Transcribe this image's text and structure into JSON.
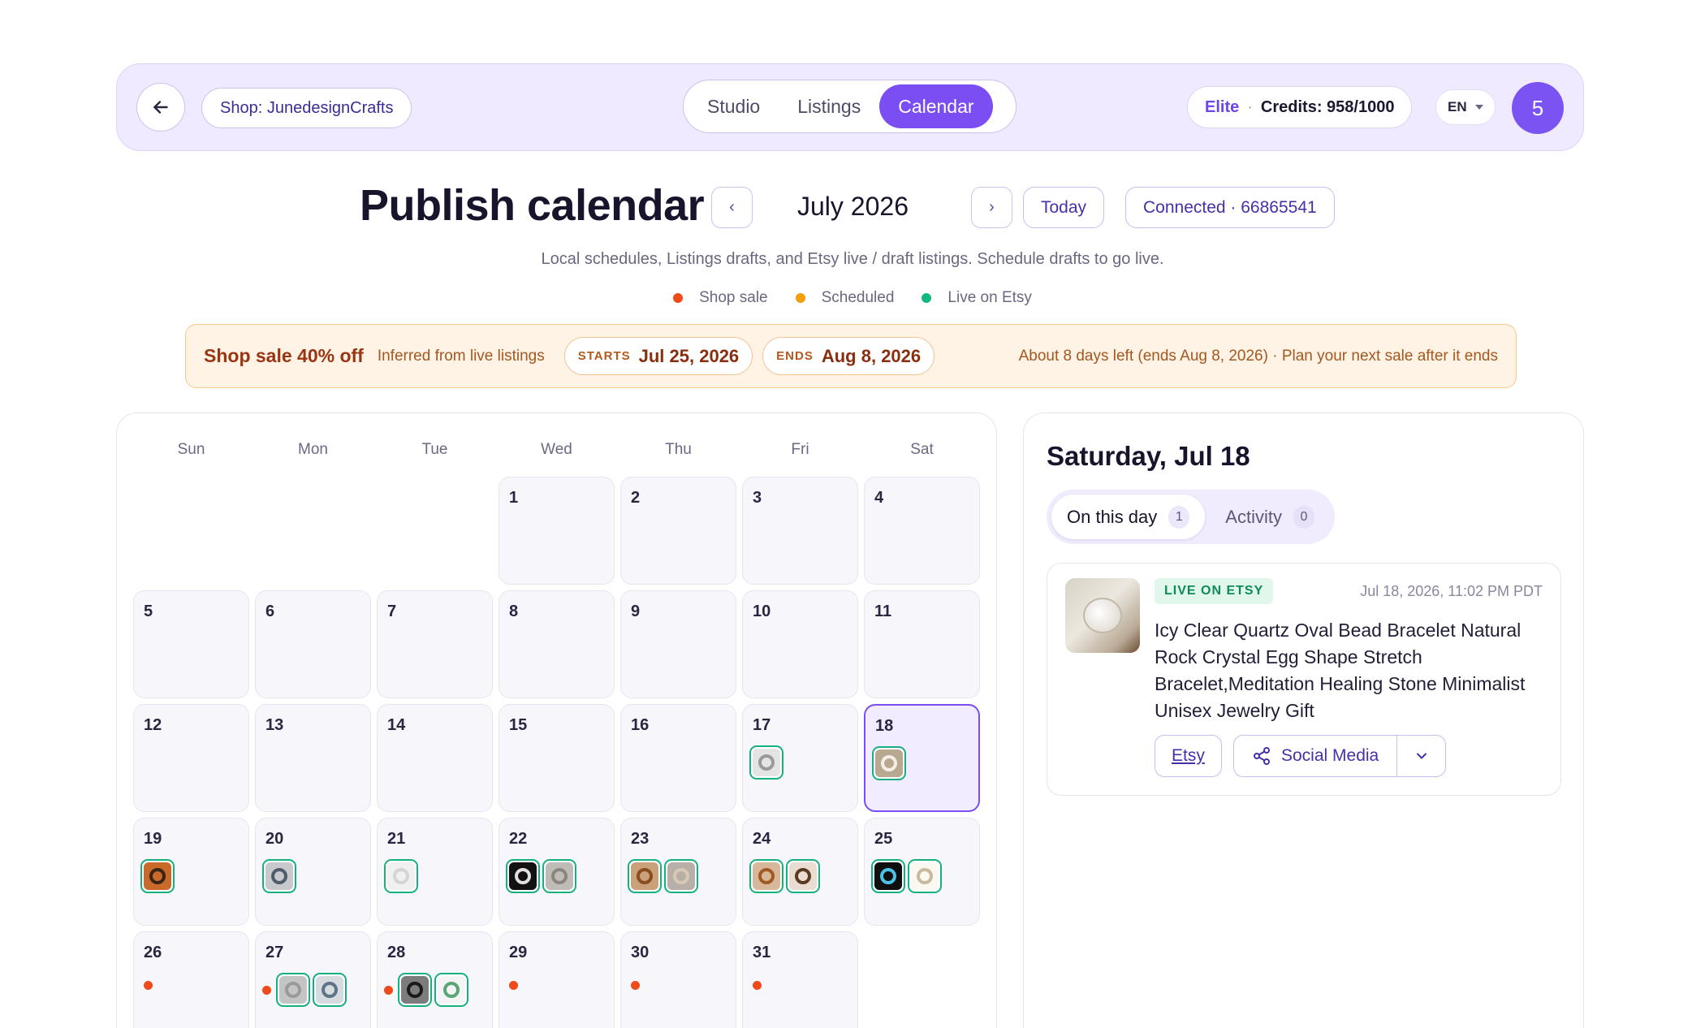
{
  "nav": {
    "shop_label": "Shop: JunedesignCrafts",
    "tabs": [
      {
        "label": "Studio",
        "active": false
      },
      {
        "label": "Listings",
        "active": false
      },
      {
        "label": "Calendar",
        "active": true
      }
    ],
    "tier": "Elite",
    "credits": "Credits: 958/1000",
    "language": "EN",
    "avatar_initial": "5",
    "icons": {
      "back": "arrow-left-icon",
      "language_caret": "chevron-down-icon"
    }
  },
  "header": {
    "title": "Publish calendar",
    "prev_label": "‹",
    "next_label": "›",
    "month_label": "July 2026",
    "today_label": "Today",
    "connected_label": "Connected · 66865541",
    "subtitle": "Local schedules, Listings drafts, and Etsy live / draft listings. Schedule drafts to go live."
  },
  "legend": [
    {
      "label": "Shop sale",
      "color": "#ef4a1a"
    },
    {
      "label": "Scheduled",
      "color": "#f59e0b"
    },
    {
      "label": "Live on Etsy",
      "color": "#10b981"
    }
  ],
  "sale_banner": {
    "title": "Shop sale 40% off",
    "inferred": "Inferred from live listings",
    "starts_label": "STARTS",
    "starts_value": "Jul 25, 2026",
    "ends_label": "ENDS",
    "ends_value": "Aug 8, 2026",
    "note": "About 8 days left (ends Aug 8, 2026) · Plan your next sale after it ends"
  },
  "calendar": {
    "weekdays": [
      "Sun",
      "Mon",
      "Tue",
      "Wed",
      "Thu",
      "Fri",
      "Sat"
    ],
    "leading_blank_days": 3,
    "selected_day": 18,
    "days": [
      {
        "day": "1",
        "sale": false,
        "items": []
      },
      {
        "day": "2",
        "sale": false,
        "items": []
      },
      {
        "day": "3",
        "sale": false,
        "items": []
      },
      {
        "day": "4",
        "sale": false,
        "items": []
      },
      {
        "day": "5",
        "sale": false,
        "items": []
      },
      {
        "day": "6",
        "sale": false,
        "items": []
      },
      {
        "day": "7",
        "sale": false,
        "items": []
      },
      {
        "day": "8",
        "sale": false,
        "items": []
      },
      {
        "day": "9",
        "sale": false,
        "items": []
      },
      {
        "day": "10",
        "sale": false,
        "items": []
      },
      {
        "day": "11",
        "sale": false,
        "items": []
      },
      {
        "day": "12",
        "sale": false,
        "items": []
      },
      {
        "day": "13",
        "sale": false,
        "items": []
      },
      {
        "day": "14",
        "sale": false,
        "items": []
      },
      {
        "day": "15",
        "sale": false,
        "items": []
      },
      {
        "day": "16",
        "sale": false,
        "items": []
      },
      {
        "day": "17",
        "sale": false,
        "items": [
          {
            "bg": "#e4e4e4",
            "ring": "#9a9a9a"
          }
        ]
      },
      {
        "day": "18",
        "sale": false,
        "items": [
          {
            "bg": "#b8a890",
            "ring": "#f4efe6"
          }
        ]
      },
      {
        "day": "19",
        "sale": false,
        "items": [
          {
            "bg": "#c96a2a",
            "ring": "#3a2418"
          }
        ]
      },
      {
        "day": "20",
        "sale": false,
        "items": [
          {
            "bg": "#c7c9cc",
            "ring": "#4f5a6b"
          }
        ]
      },
      {
        "day": "21",
        "sale": false,
        "items": [
          {
            "bg": "#f0f0f0",
            "ring": "#d4d4d4"
          }
        ]
      },
      {
        "day": "22",
        "sale": false,
        "items": [
          {
            "bg": "#121212",
            "ring": "#e0e0e0"
          },
          {
            "bg": "#bfbcb8",
            "ring": "#8c857c"
          }
        ]
      },
      {
        "day": "23",
        "sale": false,
        "items": [
          {
            "bg": "#c9a27c",
            "ring": "#8a4d1e"
          },
          {
            "bg": "#b8b0a8",
            "ring": "#d8c9b5"
          }
        ]
      },
      {
        "day": "24",
        "sale": false,
        "items": [
          {
            "bg": "#d8b89a",
            "ring": "#a05a22"
          },
          {
            "bg": "#e8ddd0",
            "ring": "#5a3a22"
          }
        ]
      },
      {
        "day": "25",
        "sale": false,
        "items": [
          {
            "bg": "#0f0f0f",
            "ring": "#4cc3e6"
          },
          {
            "bg": "#fbf8f2",
            "ring": "#c9b99f"
          }
        ]
      },
      {
        "day": "26",
        "sale": true,
        "items": []
      },
      {
        "day": "27",
        "sale": true,
        "items": [
          {
            "bg": "#c4c4c4",
            "ring": "#9a9a9a"
          },
          {
            "bg": "#d6dbe0",
            "ring": "#5f7386"
          }
        ]
      },
      {
        "day": "28",
        "sale": true,
        "items": [
          {
            "bg": "#7c7c7c",
            "ring": "#1a1a1a"
          },
          {
            "bg": "#f4f4f4",
            "ring": "#5aa574"
          }
        ]
      },
      {
        "day": "29",
        "sale": true,
        "items": []
      },
      {
        "day": "30",
        "sale": true,
        "items": []
      },
      {
        "day": "31",
        "sale": true,
        "items": []
      }
    ]
  },
  "detail": {
    "title": "Saturday, Jul 18",
    "tabs": [
      {
        "label": "On this day",
        "count": "1",
        "active": true
      },
      {
        "label": "Activity",
        "count": "0",
        "active": false
      }
    ],
    "card": {
      "badge": "LIVE ON ETSY",
      "timestamp": "Jul 18, 2026, 11:02 PM PDT",
      "title": "Icy Clear Quartz Oval Bead Bracelet Natural Rock Crystal Egg Shape Stretch Bracelet,Meditation Healing Stone Minimalist Unisex Jewelry Gift",
      "etsy_label": "Etsy",
      "share_label": "Social Media",
      "icons": {
        "share": "share-icon",
        "dropdown": "chevron-down-icon"
      }
    }
  },
  "colors": {
    "accent": "#7a4ef2",
    "sale": "#ef4a1a",
    "live": "#10b981"
  }
}
